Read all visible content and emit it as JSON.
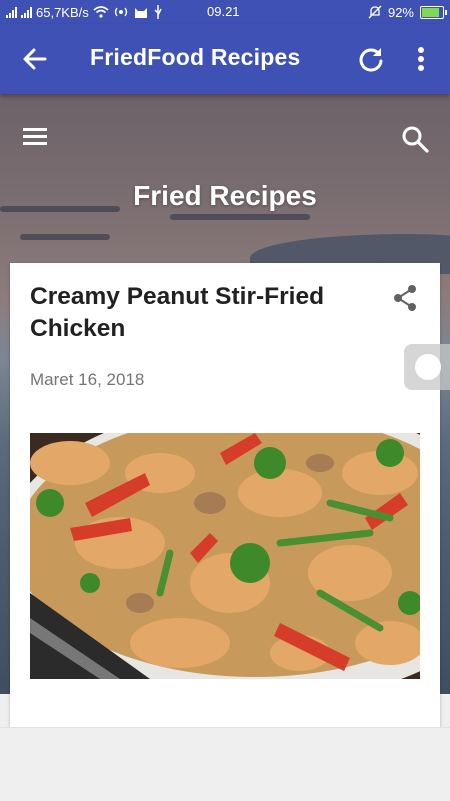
{
  "status_bar": {
    "network_speed": "65,7KB/s",
    "time": "09.21",
    "battery": "92%"
  },
  "app_bar": {
    "title": "FriedFood Recipes",
    "icons": [
      "back-arrow-icon",
      "refresh-icon",
      "more-vert-icon"
    ]
  },
  "blog_header": {
    "title": "Fried Recipes",
    "icons": [
      "menu-icon",
      "search-icon"
    ]
  },
  "post": {
    "title": "Creamy Peanut Stir-Fried Chicken",
    "date": "Maret 16, 2018",
    "share_icon": "share-icon",
    "image_alt": "chicken-stir-fry-photo"
  },
  "colors": {
    "primary": "#3f51b5",
    "card_bg": "#ffffff",
    "title_text": "#212121",
    "date_text": "#757575"
  }
}
